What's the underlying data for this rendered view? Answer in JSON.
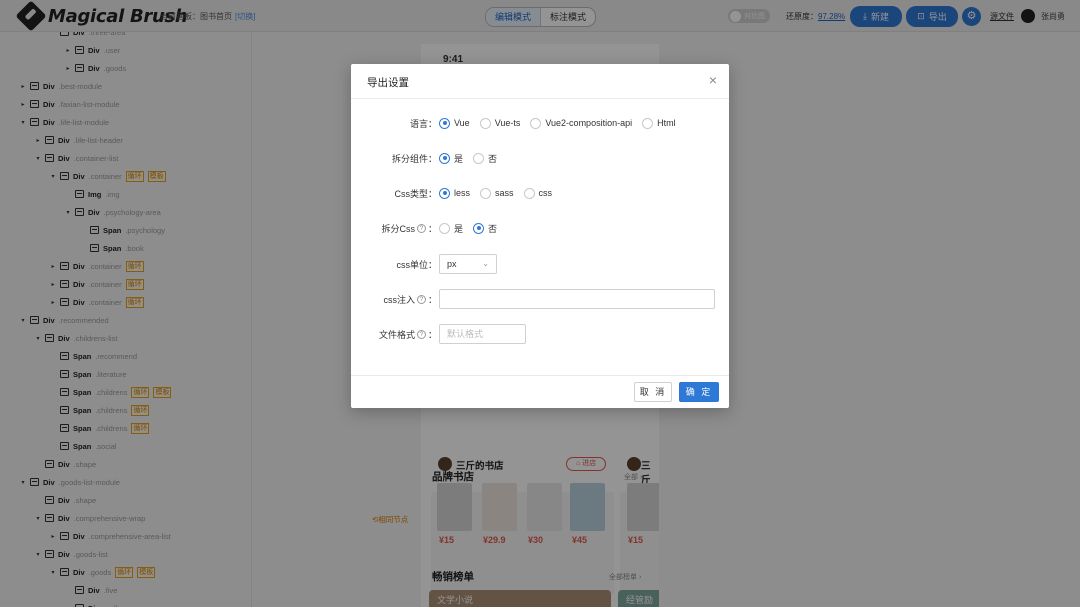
{
  "header": {
    "logo_text": "Magical Brush",
    "canvas_label": "当前画板：图书首页",
    "switch_label": "[切换]",
    "mode_tabs": [
      "编辑模式",
      "标注模式"
    ],
    "compare_toggle": "对比图",
    "restore_label": "还原度：",
    "restore_value": "97.28%",
    "new_button": "新建",
    "export_button": "导出",
    "doc_link": "源文件",
    "user_name": "张尚勇"
  },
  "tree": [
    {
      "arrow": "",
      "name": "Div",
      "cls": ".three-area",
      "tags": [],
      "indent": 3
    },
    {
      "arrow": "▸",
      "name": "Div",
      "cls": ".user",
      "tags": [],
      "indent": 4
    },
    {
      "arrow": "▸",
      "name": "Div",
      "cls": ".goods",
      "tags": [],
      "indent": 4
    },
    {
      "arrow": "▸",
      "name": "Div",
      "cls": ".best-module",
      "tags": [],
      "indent": 1
    },
    {
      "arrow": "▸",
      "name": "Div",
      "cls": ".faxian-list-module",
      "tags": [],
      "indent": 1
    },
    {
      "arrow": "▾",
      "name": "Div",
      "cls": ".life-list-module",
      "tags": [],
      "indent": 1
    },
    {
      "arrow": "▸",
      "name": "Div",
      "cls": ".life-list-header",
      "tags": [],
      "indent": 2
    },
    {
      "arrow": "▾",
      "name": "Div",
      "cls": ".container-list",
      "tags": [],
      "indent": 2
    },
    {
      "arrow": "▾",
      "name": "Div",
      "cls": ".container",
      "tags": [
        "循环",
        "模板"
      ],
      "indent": 3
    },
    {
      "arrow": "",
      "name": "Img",
      "cls": ".img",
      "tags": [],
      "indent": 4
    },
    {
      "arrow": "▾",
      "name": "Div",
      "cls": ".psychology-area",
      "tags": [],
      "indent": 4
    },
    {
      "arrow": "",
      "name": "Span",
      "cls": ".psychology",
      "tags": [],
      "indent": 5
    },
    {
      "arrow": "",
      "name": "Span",
      "cls": ".book",
      "tags": [],
      "indent": 5
    },
    {
      "arrow": "▸",
      "name": "Div",
      "cls": ".container",
      "tags": [
        "循环"
      ],
      "indent": 3
    },
    {
      "arrow": "▸",
      "name": "Div",
      "cls": ".container",
      "tags": [
        "循环"
      ],
      "indent": 3
    },
    {
      "arrow": "▸",
      "name": "Div",
      "cls": ".container",
      "tags": [
        "循环"
      ],
      "indent": 3
    },
    {
      "arrow": "▾",
      "name": "Div",
      "cls": ".recommended",
      "tags": [],
      "indent": 1
    },
    {
      "arrow": "▾",
      "name": "Div",
      "cls": ".childrens-list",
      "tags": [],
      "indent": 2
    },
    {
      "arrow": "",
      "name": "Span",
      "cls": ".recommend",
      "tags": [],
      "indent": 3
    },
    {
      "arrow": "",
      "name": "Span",
      "cls": ".literature",
      "tags": [],
      "indent": 3
    },
    {
      "arrow": "",
      "name": "Span",
      "cls": ".childrens",
      "tags": [
        "循环",
        "模板"
      ],
      "indent": 3
    },
    {
      "arrow": "",
      "name": "Span",
      "cls": ".childrens",
      "tags": [
        "循环"
      ],
      "indent": 3
    },
    {
      "arrow": "",
      "name": "Span",
      "cls": ".childrens",
      "tags": [
        "循环"
      ],
      "indent": 3
    },
    {
      "arrow": "",
      "name": "Span",
      "cls": ".social",
      "tags": [],
      "indent": 3
    },
    {
      "arrow": "",
      "name": "Div",
      "cls": ".shape",
      "tags": [],
      "indent": 2
    },
    {
      "arrow": "▾",
      "name": "Div",
      "cls": ".goods-list-module",
      "tags": [],
      "indent": 1
    },
    {
      "arrow": "",
      "name": "Div",
      "cls": ".shape",
      "tags": [],
      "indent": 2
    },
    {
      "arrow": "▾",
      "name": "Div",
      "cls": ".comprehensive-wrap",
      "tags": [],
      "indent": 2
    },
    {
      "arrow": "▸",
      "name": "Div",
      "cls": ".comprehensive-area-list",
      "tags": [],
      "indent": 3
    },
    {
      "arrow": "▾",
      "name": "Div",
      "cls": ".goods-list",
      "tags": [],
      "indent": 2
    },
    {
      "arrow": "▾",
      "name": "Div",
      "cls": ".goods",
      "tags": [
        "循环",
        "模板"
      ],
      "indent": 3
    },
    {
      "arrow": "",
      "name": "Div",
      "cls": ".five",
      "tags": [],
      "indent": 4
    },
    {
      "arrow": "▸",
      "name": "Div",
      "cls": ".self-area",
      "tags": [],
      "indent": 4
    }
  ],
  "locate_node": "相同节点",
  "phone": {
    "time": "9:41",
    "brand_title": "品牌书店",
    "brand_more": "全部 ›",
    "shop_name": "三斤的书店",
    "shop_name_2": "三斤",
    "enter_button": "进店",
    "prices": [
      "¥15",
      "¥29.9",
      "¥30",
      "¥45",
      "¥15"
    ],
    "rank_title": "畅销榜单",
    "rank_more": "全部榜单 ›",
    "rank_tabs": [
      "文学小说",
      "经管励"
    ]
  },
  "modal": {
    "title": "导出设置",
    "language": {
      "label": "语言：",
      "options": [
        "Vue",
        "Vue-ts",
        "Vue2-composition-api",
        "Html"
      ],
      "selected": 0
    },
    "split_component": {
      "label": "拆分组件：",
      "options": [
        "是",
        "否"
      ],
      "selected": 0
    },
    "css_type": {
      "label": "Css类型：",
      "options": [
        "less",
        "sass",
        "css"
      ],
      "selected": 0
    },
    "split_css": {
      "label": "拆分Css",
      "colon": "：",
      "options": [
        "是",
        "否"
      ],
      "selected": 1
    },
    "css_unit": {
      "label": "css单位：",
      "value": "px"
    },
    "css_inject": {
      "label": "css注入",
      "colon": "：",
      "value": ""
    },
    "file_format": {
      "label": "文件格式",
      "colon": "：",
      "placeholder": "默认格式"
    },
    "cancel": "取 消",
    "confirm": "确 定"
  },
  "colors": {
    "primary": "#2f79d6",
    "price": "#e0584e",
    "tag": "#d08000"
  }
}
